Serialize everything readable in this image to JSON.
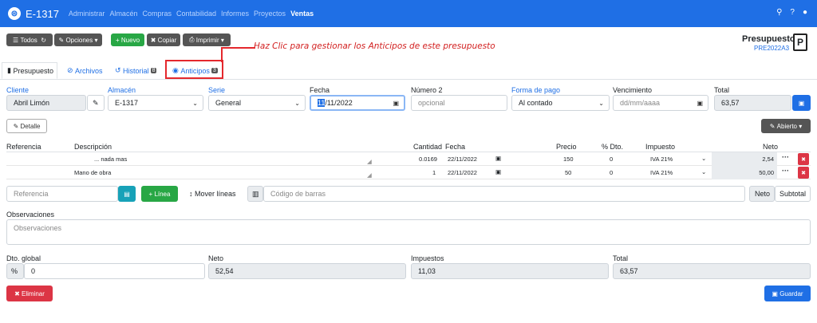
{
  "nav": {
    "title": "E-1317",
    "logo_glyph": "⊜",
    "menu": [
      "Administrar",
      "Almacén",
      "Compras",
      "Contabilidad",
      "Informes",
      "Proyectos",
      "Ventas"
    ],
    "icons": [
      "search-icon",
      "help-icon",
      "user-icon"
    ]
  },
  "toolbar": {
    "todos": "Todos",
    "opciones": "Opciones",
    "nuevo": "Nuevo",
    "copiar": "Copiar",
    "imprimir": "Imprimir"
  },
  "annotation": "Haz Clic para gestionar los Anticipos de este presupuesto",
  "doc": {
    "type": "Presupuesto",
    "code": "PRE2022A3",
    "icon_letter": "P"
  },
  "tabs": [
    {
      "label": "Presupuesto"
    },
    {
      "label": "Archivos"
    },
    {
      "label": "Historial",
      "badge": "8"
    },
    {
      "label": "Anticipos",
      "badge": "3"
    }
  ],
  "form": {
    "cliente": {
      "label": "Cliente",
      "value": "Abril Limón"
    },
    "almacen": {
      "label": "Almacén",
      "value": "E-1317"
    },
    "serie": {
      "label": "Serie",
      "value": "General"
    },
    "fecha": {
      "label": "Fecha",
      "value_day": "11",
      "value_rest": "/11/2022"
    },
    "numero2": {
      "label": "Número 2",
      "placeholder": "opcional"
    },
    "forma_pago": {
      "label": "Forma de pago",
      "value": "Al contado"
    },
    "vencimiento": {
      "label": "Vencimiento",
      "placeholder": "dd/mm/aaaa"
    },
    "total": {
      "label": "Total",
      "value": "63,57"
    }
  },
  "detalle": "Detalle",
  "estado": "Abierto",
  "lines": {
    "headers": {
      "referencia": "Referencia",
      "descripcion": "Descripción",
      "cantidad": "Cantidad",
      "fecha": "Fecha",
      "precio": "Precio",
      "dto": "% Dto.",
      "impuesto": "Impuesto",
      "neto": "Neto"
    },
    "rows": [
      {
        "descripcion": "... nada mas",
        "cantidad": "0.0169",
        "fecha": "22/11/2022",
        "precio": "150",
        "dto": "0",
        "impuesto": "IVA 21%",
        "neto": "2,54"
      },
      {
        "descripcion": "Mano de obra",
        "cantidad": "1",
        "fecha": "22/11/2022",
        "precio": "50",
        "dto": "0",
        "impuesto": "IVA 21%",
        "neto": "50,00"
      }
    ]
  },
  "addline": {
    "ref_placeholder": "Referencia",
    "linea": "Línea",
    "mover": "Mover líneas",
    "barcode_placeholder": "Código de barras",
    "neto": "Neto",
    "subtotal": "Subtotal"
  },
  "observaciones": {
    "label": "Observaciones",
    "placeholder": "Observaciones"
  },
  "totals": {
    "dto_label": "Dto. global",
    "dto_value": "0",
    "neto_label": "Neto",
    "neto_value": "52,54",
    "impuestos_label": "Impuestos",
    "impuestos_value": "11,03",
    "total_label": "Total",
    "total_value": "63,57"
  },
  "eliminar": "Eliminar",
  "guardar": "Guardar"
}
